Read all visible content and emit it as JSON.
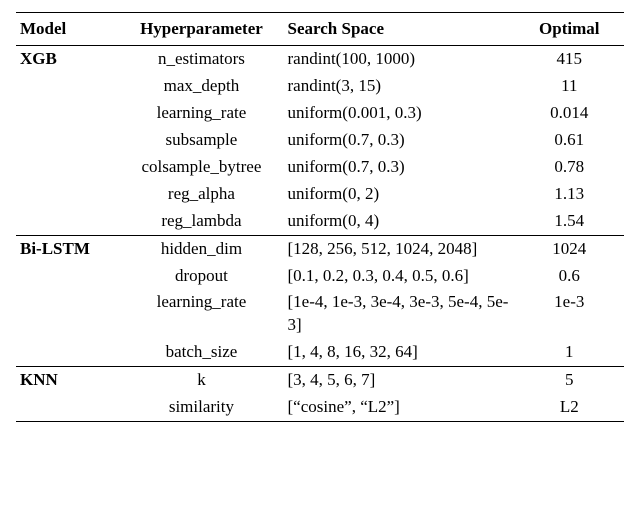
{
  "headers": {
    "model": "Model",
    "hyper": "Hyperparameter",
    "space": "Search Space",
    "optimal": "Optimal"
  },
  "groups": [
    {
      "model": "XGB",
      "rows": [
        {
          "hyper": "n_estimators",
          "space": "randint(100, 1000)",
          "optimal": "415"
        },
        {
          "hyper": "max_depth",
          "space": "randint(3, 15)",
          "optimal": "11"
        },
        {
          "hyper": "learning_rate",
          "space": "uniform(0.001, 0.3)",
          "optimal": "0.014"
        },
        {
          "hyper": "subsample",
          "space": "uniform(0.7, 0.3)",
          "optimal": "0.61"
        },
        {
          "hyper": "colsample_bytree",
          "space": "uniform(0.7, 0.3)",
          "optimal": "0.78"
        },
        {
          "hyper": "reg_alpha",
          "space": "uniform(0, 2)",
          "optimal": "1.13"
        },
        {
          "hyper": "reg_lambda",
          "space": "uniform(0, 4)",
          "optimal": "1.54"
        }
      ]
    },
    {
      "model": "Bi-LSTM",
      "rows": [
        {
          "hyper": "hidden_dim",
          "space": "[128, 256, 512, 1024, 2048]",
          "optimal": "1024"
        },
        {
          "hyper": "dropout",
          "space": "[0.1, 0.2, 0.3, 0.4, 0.5, 0.6]",
          "optimal": "0.6"
        },
        {
          "hyper": "learning_rate",
          "space": "[1e-4, 1e-3, 3e-4, 3e-3, 5e-4, 5e-3]",
          "optimal": "1e-3"
        },
        {
          "hyper": "batch_size",
          "space": "[1, 4, 8, 16, 32, 64]",
          "optimal": "1"
        }
      ]
    },
    {
      "model": "KNN",
      "rows": [
        {
          "hyper": "k",
          "space": "[3, 4, 5, 6, 7]",
          "optimal": "5"
        },
        {
          "hyper": "similarity",
          "space": "[“cosine”, “L2”]",
          "optimal": "L2"
        }
      ]
    }
  ],
  "chart_data": {
    "type": "table",
    "columns": [
      "Model",
      "Hyperparameter",
      "Search Space",
      "Optimal"
    ],
    "rows": [
      [
        "XGB",
        "n_estimators",
        "randint(100, 1000)",
        415
      ],
      [
        "XGB",
        "max_depth",
        "randint(3, 15)",
        11
      ],
      [
        "XGB",
        "learning_rate",
        "uniform(0.001, 0.3)",
        0.014
      ],
      [
        "XGB",
        "subsample",
        "uniform(0.7, 0.3)",
        0.61
      ],
      [
        "XGB",
        "colsample_bytree",
        "uniform(0.7, 0.3)",
        0.78
      ],
      [
        "XGB",
        "reg_alpha",
        "uniform(0, 2)",
        1.13
      ],
      [
        "XGB",
        "reg_lambda",
        "uniform(0, 4)",
        1.54
      ],
      [
        "Bi-LSTM",
        "hidden_dim",
        "[128, 256, 512, 1024, 2048]",
        1024
      ],
      [
        "Bi-LSTM",
        "dropout",
        "[0.1, 0.2, 0.3, 0.4, 0.5, 0.6]",
        0.6
      ],
      [
        "Bi-LSTM",
        "learning_rate",
        "[1e-4, 1e-3, 3e-4, 3e-3, 5e-4, 5e-3]",
        "1e-3"
      ],
      [
        "Bi-LSTM",
        "batch_size",
        "[1, 4, 8, 16, 32, 64]",
        1
      ],
      [
        "KNN",
        "k",
        "[3, 4, 5, 6, 7]",
        5
      ],
      [
        "KNN",
        "similarity",
        "[\"cosine\", \"L2\"]",
        "L2"
      ]
    ]
  }
}
